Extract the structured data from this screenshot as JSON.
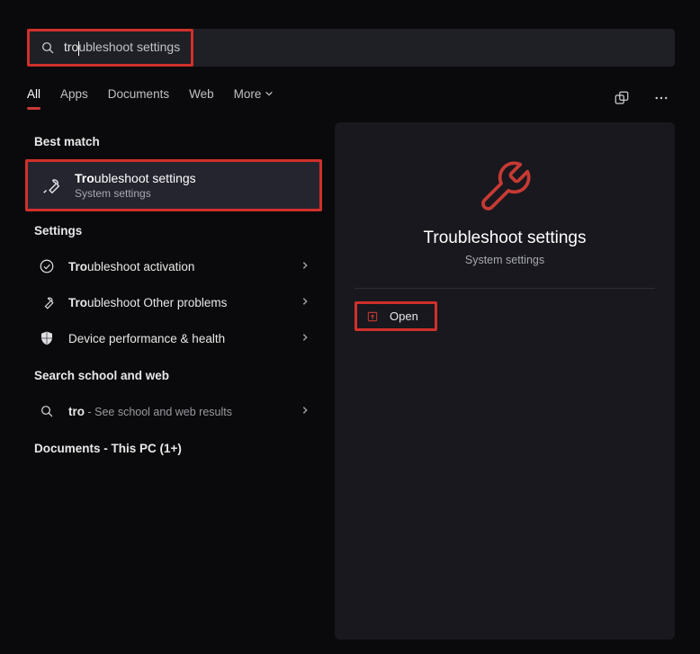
{
  "search": {
    "typed": "tro",
    "completion": "ubleshoot settings"
  },
  "tabs": {
    "items": [
      "All",
      "Apps",
      "Documents",
      "Web",
      "More"
    ],
    "activeIndex": 0
  },
  "sections": {
    "best_match": "Best match",
    "settings": "Settings",
    "search_web": "Search school and web",
    "documents": "Documents - This PC (1+)"
  },
  "bestMatch": {
    "titlePrefix": "Tro",
    "titleRest": "ubleshoot settings",
    "subtitle": "System settings"
  },
  "settingsList": [
    {
      "prefix": "Tro",
      "rest": "ubleshoot activation",
      "icon": "check"
    },
    {
      "prefix": "Tro",
      "rest": "ubleshoot Other problems",
      "icon": "wrench"
    },
    {
      "prefix": "",
      "rest": "Device performance & health",
      "icon": "shield"
    }
  ],
  "webResult": {
    "prefix": "tro",
    "suffix": " - ",
    "desc": "See school and web results"
  },
  "preview": {
    "title": "Troubleshoot settings",
    "subtitle": "System settings",
    "openLabel": "Open"
  }
}
